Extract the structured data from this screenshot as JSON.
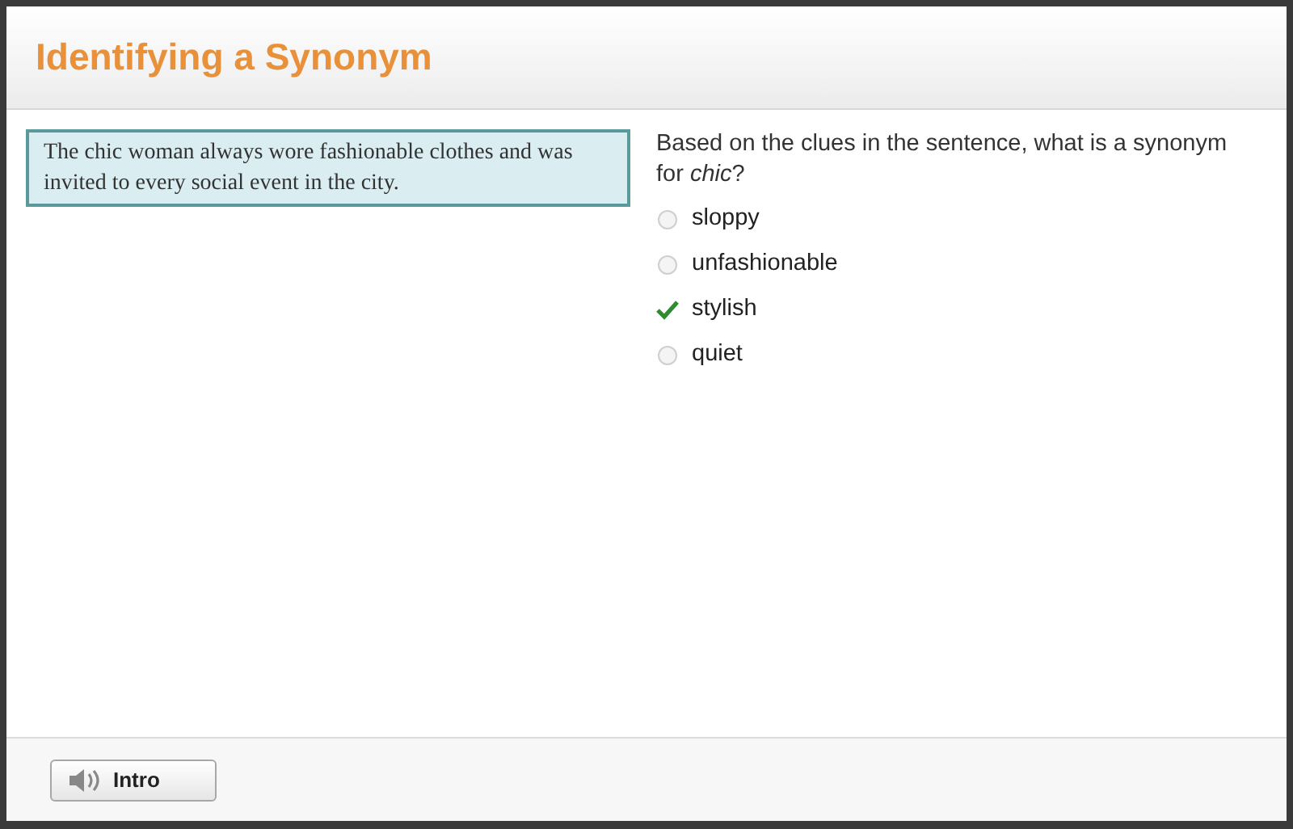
{
  "title": "Identifying a Synonym",
  "passage": "The chic woman always wore fashionable clothes and was invited to every social event in the city.",
  "question": "Based on the clues in the sentence, what is a synonym for *chic*?",
  "options": [
    {
      "label": "sloppy",
      "selected": false
    },
    {
      "label": "unfashionable",
      "selected": false
    },
    {
      "label": "stylish",
      "selected": true
    },
    {
      "label": "quiet",
      "selected": false
    }
  ],
  "footer": {
    "button": "Intro"
  }
}
